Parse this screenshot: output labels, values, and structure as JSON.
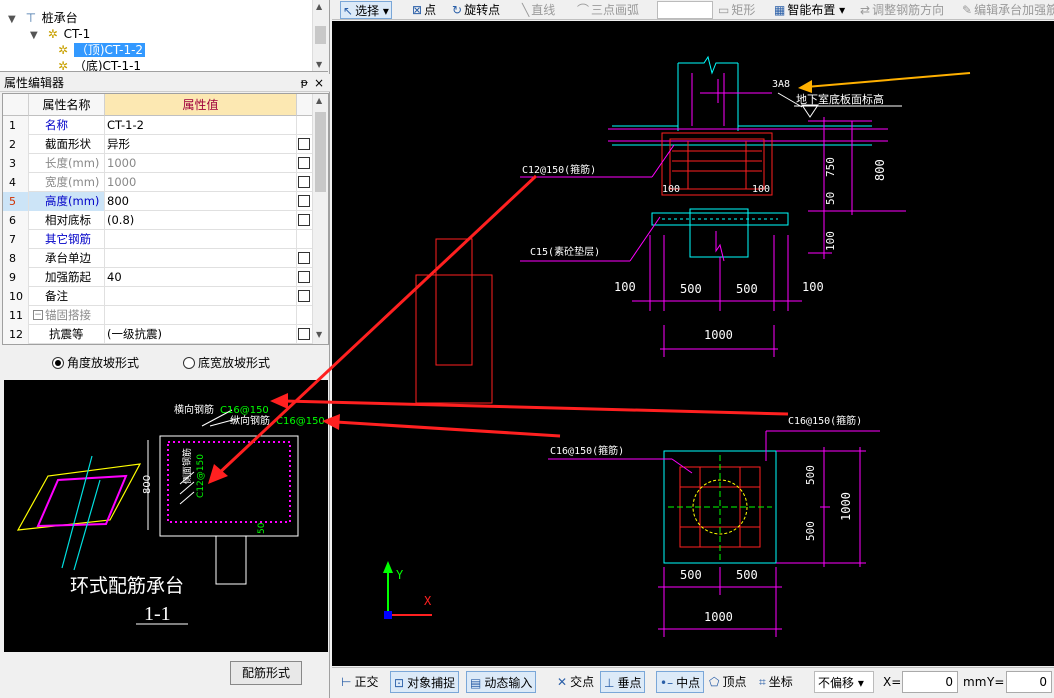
{
  "tree": {
    "root": "桩承台",
    "child": "CT-1",
    "item_selected": "（顶)CT-1-2",
    "item_next": "（底)CT-1-1"
  },
  "panel": {
    "title": "属性编辑器",
    "pin": "ᵽ",
    "close": "×"
  },
  "grid": {
    "col_name": "属性名称",
    "col_value": "属性值",
    "rows": [
      {
        "n": "1",
        "name": "名称",
        "value": "CT-1-2"
      },
      {
        "n": "2",
        "name": "截面形状",
        "value": "异形"
      },
      {
        "n": "3",
        "name": "长度(mm)",
        "value": "1000"
      },
      {
        "n": "4",
        "name": "宽度(mm)",
        "value": "1000"
      },
      {
        "n": "5",
        "name": "高度(mm)",
        "value": "800"
      },
      {
        "n": "6",
        "name": "相对底标",
        "value": "(0.8)"
      },
      {
        "n": "7",
        "name": "其它钢筋",
        "value": ""
      },
      {
        "n": "8",
        "name": "承台单边",
        "value": ""
      },
      {
        "n": "9",
        "name": "加强筋起",
        "value": "40"
      },
      {
        "n": "10",
        "name": "备注",
        "value": ""
      },
      {
        "n": "11",
        "name": "锚固搭接",
        "value": ""
      },
      {
        "n": "12",
        "name": "抗震等",
        "value": "(一级抗震)"
      }
    ]
  },
  "radios": {
    "opt1": "角度放坡形式",
    "opt2": "底宽放坡形式"
  },
  "preview": {
    "label_h": "横向钢筋",
    "label_h_val": "C16@150",
    "label_v": "纵向钢筋",
    "label_v_val": "C16@150",
    "dim": "800",
    "side_bar": "侧面钢筋",
    "side_bar_val": "C12@150",
    "small_dim": "50",
    "title": "环式配筋承台",
    "section": "1-1"
  },
  "button_rebar": "配筋形式",
  "toolbar": {
    "select": "选择",
    "point": "点",
    "rotate_point": "旋转点",
    "line": "直线",
    "arc3": "三点画弧",
    "rect": "矩形",
    "smart": "智能布置",
    "adjust": "调整钢筋方向",
    "edit": "编辑承台加强筋"
  },
  "cad": {
    "bar_3a8": "3A8",
    "basement_label": "地下室底板面标高",
    "c12_label": "C12@150(箍筋)",
    "c15_label": "C15(素砼垫层)",
    "d100a": "100",
    "d100b": "100",
    "d750": "750",
    "d50": "50",
    "d800": "800",
    "d100c": "100",
    "d100_left": "100",
    "d500a": "500",
    "d500b": "500",
    "d100_right": "100",
    "d1000_top": "1000",
    "c16_label_right": "C16@150(箍筋)",
    "c16_label_left": "C16@150(箍筋)",
    "d500_v1": "500",
    "d500_v2": "500",
    "d1000_v": "1000",
    "d500_h1": "500",
    "d500_h2": "500",
    "d1000_bottom": "1000",
    "axis_y": "Y",
    "axis_x": "X"
  },
  "status": {
    "ortho": "正交",
    "snap": "对象捕捉",
    "dyn": "动态输入",
    "intersect": "交点",
    "perp": "垂点",
    "mid": "中点",
    "vertex": "顶点",
    "coord": "坐标",
    "offset": "不偏移",
    "x_label": "X=",
    "x_value": "0",
    "mm": "mm",
    "y_label": "Y=",
    "y_value": "0"
  },
  "colors": {
    "cad_bg": "#000000",
    "magenta": "#ff00ff",
    "red": "#ff2020",
    "cyan": "#00ffff",
    "yellow": "#ffff00",
    "orange_arrow": "#ffb000",
    "green": "#00ff00",
    "blue_text": "#0000c8"
  }
}
